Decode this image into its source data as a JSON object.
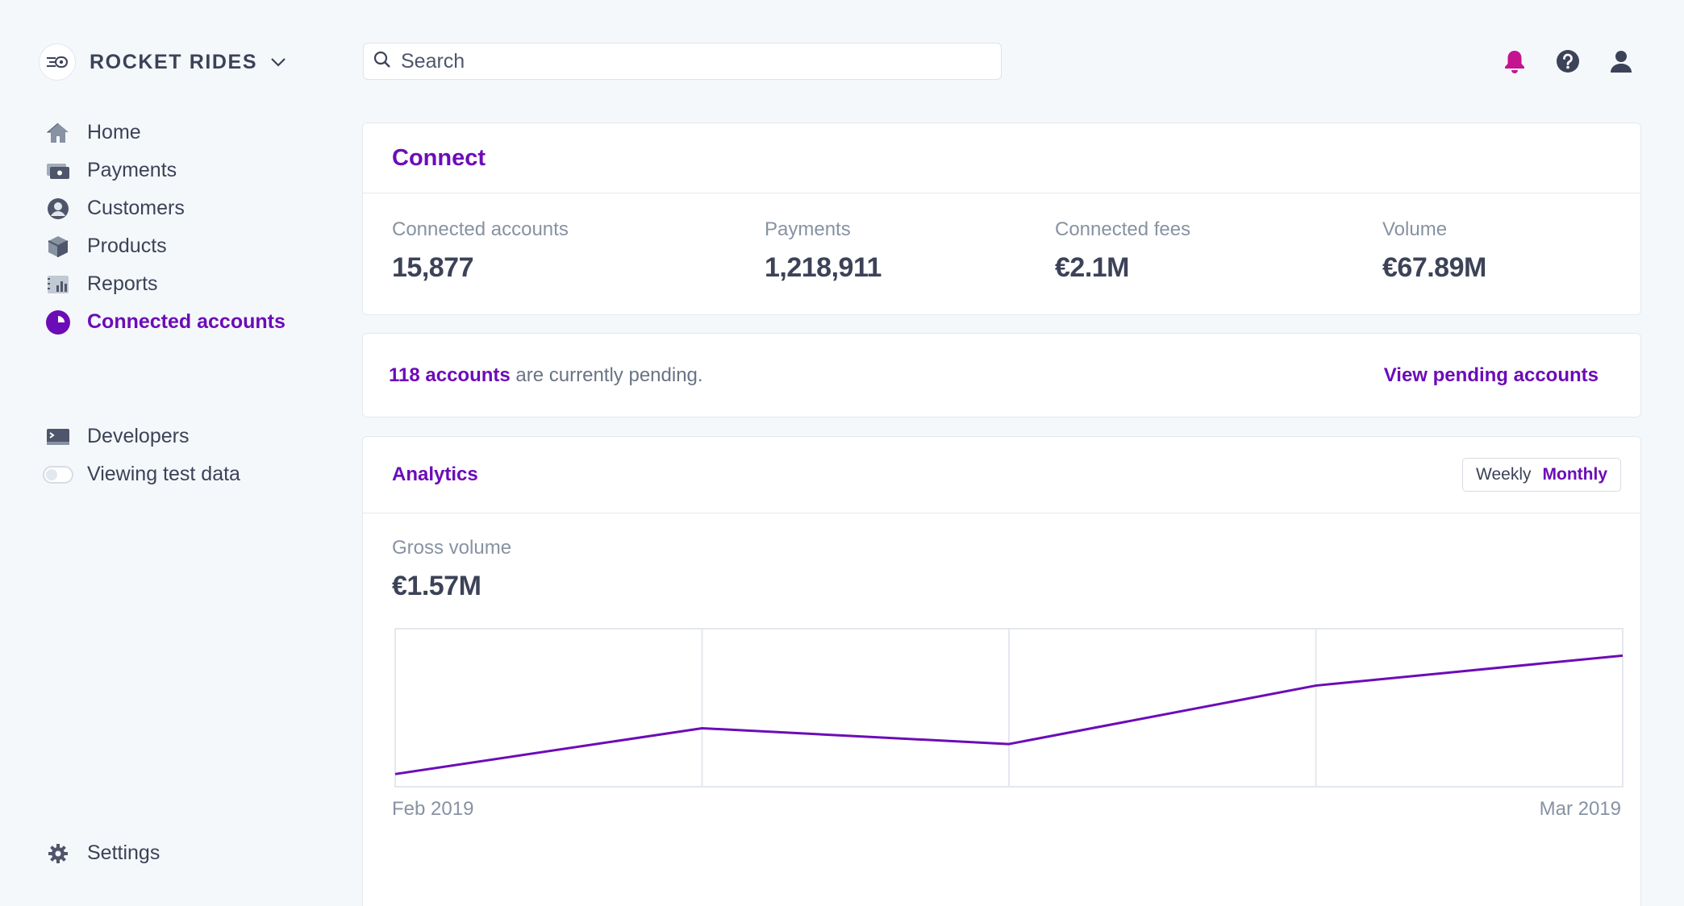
{
  "brand": {
    "name": "ROCKET RIDES"
  },
  "search": {
    "placeholder": "Search"
  },
  "sidebar": {
    "items": [
      {
        "label": "Home",
        "icon": "home-icon"
      },
      {
        "label": "Payments",
        "icon": "payments-icon"
      },
      {
        "label": "Customers",
        "icon": "customers-icon"
      },
      {
        "label": "Products",
        "icon": "products-icon"
      },
      {
        "label": "Reports",
        "icon": "reports-icon"
      },
      {
        "label": "Connected accounts",
        "icon": "connected-accounts-icon",
        "active": true
      }
    ],
    "developers": {
      "label": "Developers",
      "icon": "terminal-icon"
    },
    "test_data": {
      "label": "Viewing test data",
      "enabled": false
    },
    "settings": {
      "label": "Settings",
      "icon": "gear-icon"
    }
  },
  "topbar": {
    "icons": [
      "bell-icon",
      "help-icon",
      "user-icon"
    ]
  },
  "connect": {
    "title": "Connect",
    "stats": [
      {
        "label": "Connected accounts",
        "value": "15,877"
      },
      {
        "label": "Payments",
        "value": "1,218,911"
      },
      {
        "label": "Connected fees",
        "value": "€2.1M"
      },
      {
        "label": "Volume",
        "value": "€67.89M"
      }
    ]
  },
  "pending": {
    "count_text": "118 accounts",
    "rest_text": " are currently pending.",
    "link": "View pending accounts"
  },
  "analytics": {
    "title": "Analytics",
    "toggle": {
      "weekly": "Weekly",
      "monthly": "Monthly",
      "selected": "Monthly"
    },
    "metric_label": "Gross volume",
    "metric_value": "€1.57M"
  },
  "colors": {
    "accent": "#6c0cb8",
    "bell": "#c4148f",
    "text": "#3c4257",
    "muted": "#8792a2"
  },
  "chart_data": {
    "type": "line",
    "x": [
      "Feb 2019",
      "",
      "",
      "",
      "Mar 2019"
    ],
    "tick_labels": [
      "Feb 2019",
      "Mar 2019"
    ],
    "values": [
      0.08,
      0.37,
      0.27,
      0.64,
      0.83
    ],
    "ylim": [
      0,
      1
    ],
    "grid": true,
    "xlabel": "",
    "ylabel": "",
    "title": ""
  }
}
